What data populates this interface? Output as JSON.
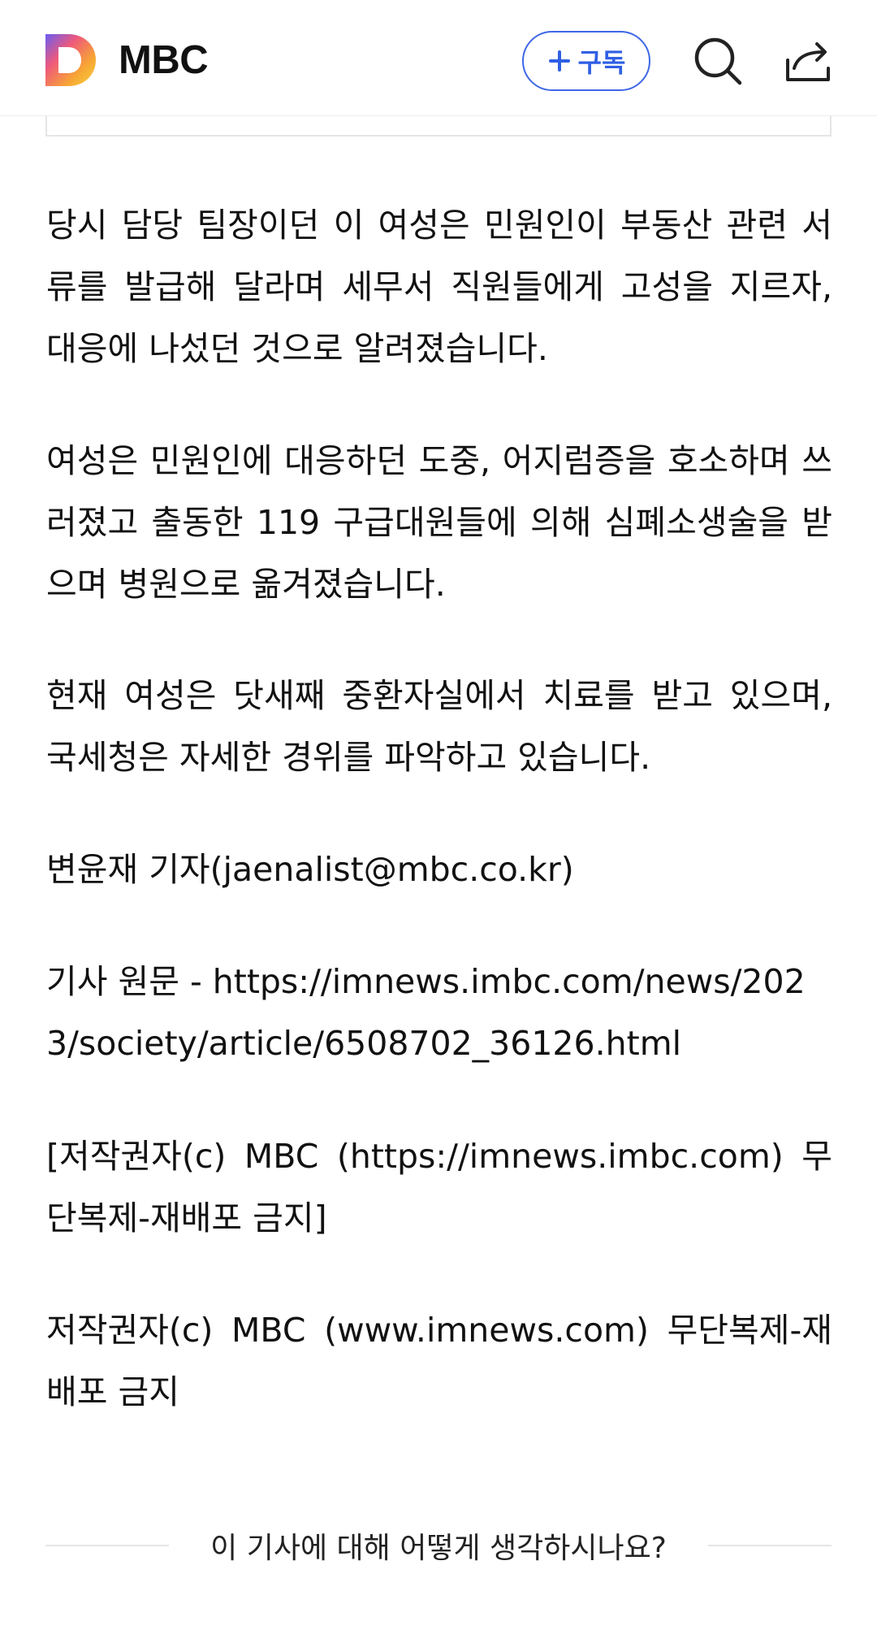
{
  "header": {
    "brand": "MBC",
    "subscribe_label": "구독"
  },
  "article": {
    "paragraphs": [
      "당시 담당 팀장이던 이 여성은 민원인이 부동산 관련 서류를 발급해 달라며 세무서 직원들에게 고성을 지르자, 대응에 나섰던 것으로 알려졌습니다.",
      "여성은 민원인에 대응하던 도중, 어지럼증을 호소하며 쓰러졌고 출동한 119 구급대원들에 의해 심폐소생술을 받으며 병원으로 옮겨졌습니다.",
      "현재 여성은 닷새째 중환자실에서 치료를 받고 있으며, 국세청은 자세한 경위를 파악하고 있습니다.",
      "변윤재 기자(jaenalist@mbc.co.kr)",
      "기사 원문 - https://imnews.imbc.com/news/2023/society/article/6508702_36126.html",
      "[저작권자(c) MBC (https://imnews.imbc.com) 무단복제-재배포 금지]",
      "저작권자(c) MBC (www.imnews.com) 무단복제-재배포 금지"
    ]
  },
  "footer": {
    "prompt": "이 기사에 대해 어떻게 생각하시나요?"
  },
  "colors": {
    "accent": "#3e68e6",
    "text": "#111111",
    "divider": "#e6e6e6"
  },
  "icons": [
    "daum-logo-icon",
    "plus-icon",
    "search-icon",
    "share-icon"
  ]
}
